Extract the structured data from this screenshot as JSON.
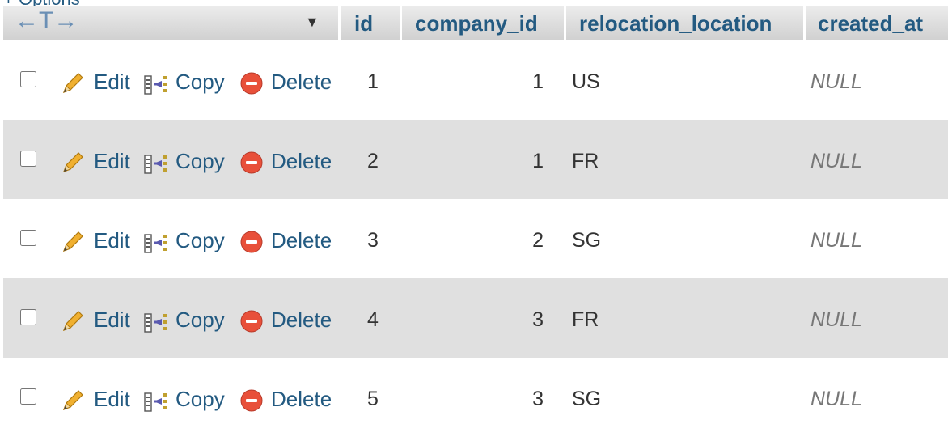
{
  "options_label": "+ Options",
  "header": {
    "sort_arrows": "←T→",
    "dropdown_glyph": "▼",
    "columns": [
      "id",
      "company_id",
      "relocation_location",
      "created_at"
    ]
  },
  "actions": {
    "edit": "Edit",
    "copy": "Copy",
    "delete": "Delete"
  },
  "rows": [
    {
      "id": "1",
      "company_id": "1",
      "relocation_location": "US",
      "created_at": "NULL"
    },
    {
      "id": "2",
      "company_id": "1",
      "relocation_location": "FR",
      "created_at": "NULL"
    },
    {
      "id": "3",
      "company_id": "2",
      "relocation_location": "SG",
      "created_at": "NULL"
    },
    {
      "id": "4",
      "company_id": "3",
      "relocation_location": "FR",
      "created_at": "NULL"
    },
    {
      "id": "5",
      "company_id": "3",
      "relocation_location": "SG",
      "created_at": "NULL"
    }
  ]
}
